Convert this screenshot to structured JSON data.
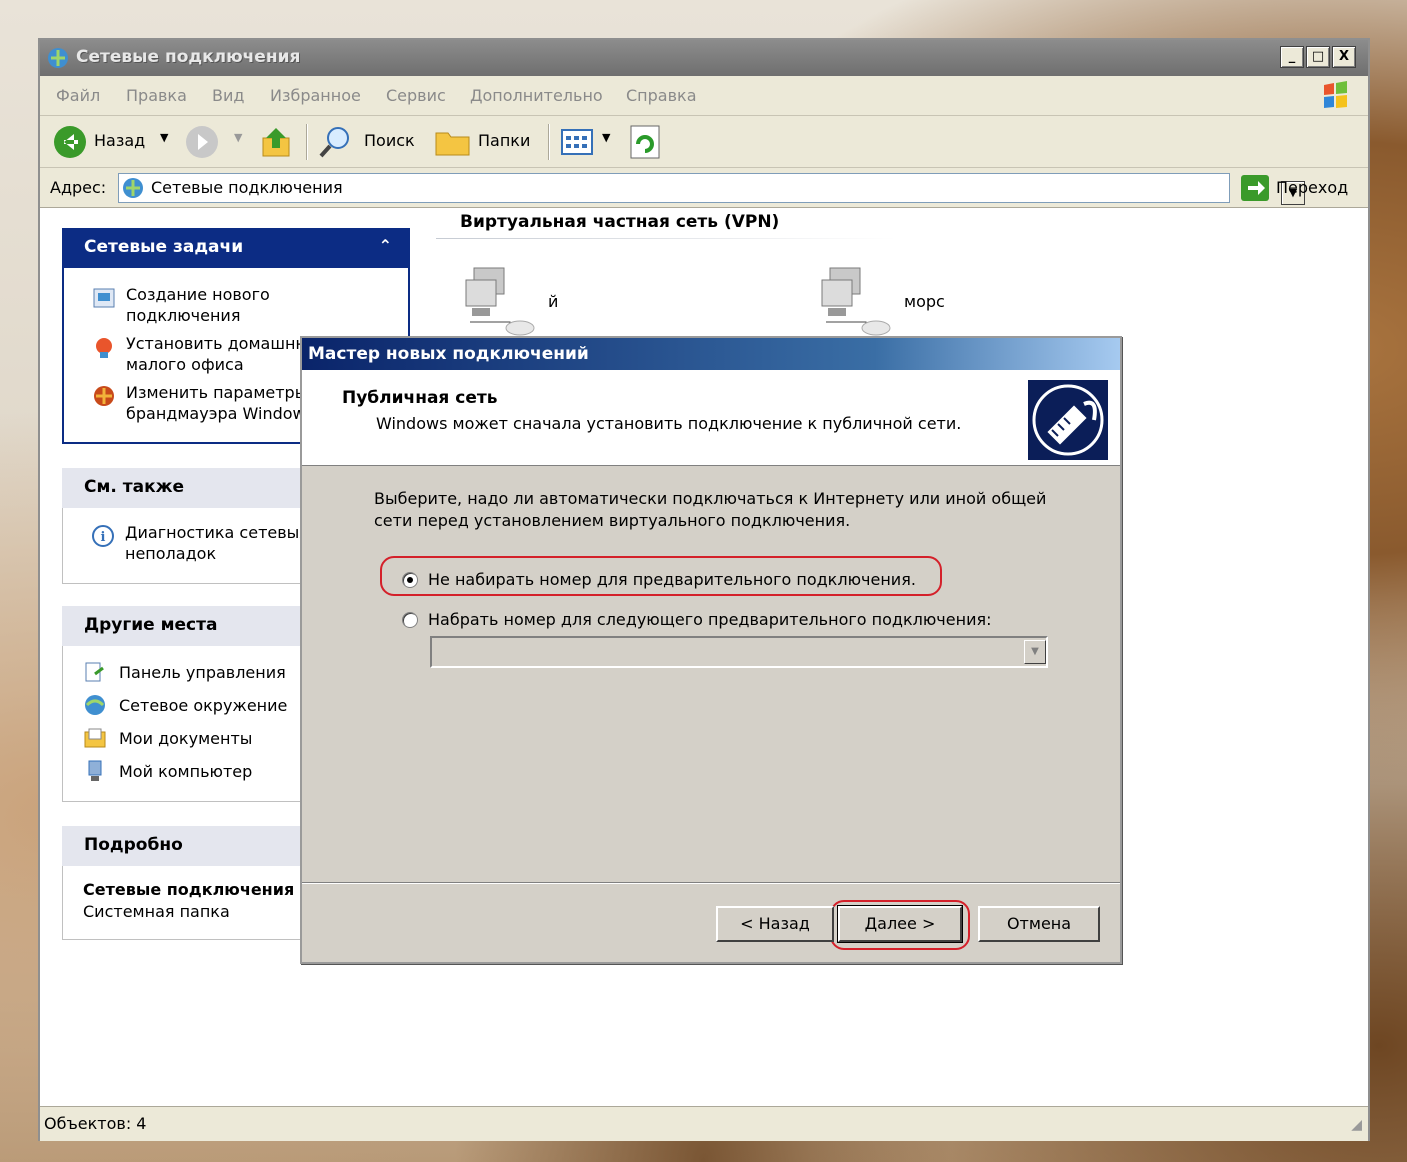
{
  "window": {
    "title": "Сетевые подключения",
    "controls": [
      "_",
      "□",
      "X"
    ]
  },
  "menu": [
    "Файл",
    "Правка",
    "Вид",
    "Избранное",
    "Сервис",
    "Дополнительно",
    "Справка"
  ],
  "toolbar": {
    "back": "Назад",
    "search": "Поиск",
    "folders": "Папки"
  },
  "address": {
    "label": "Адрес:",
    "value": "Сетевые подключения",
    "go": "Переход"
  },
  "tasks": {
    "network_tasks": {
      "title": "Сетевые задачи",
      "collapse": "«",
      "items": [
        "Создание нового подключения",
        "Установить домашнюю или сеть малого офиса",
        "Изменить параметры брандмауэра Windows"
      ]
    },
    "see_also": {
      "title": "См. также",
      "items": [
        "Диагностика сетевых неполадок"
      ]
    },
    "other_places": {
      "title": "Другие места",
      "items": [
        "Панель управления",
        "Сетевое окружение",
        "Мои документы",
        "Мой компьютер"
      ]
    },
    "details": {
      "title": "Подробно",
      "name": "Сетевые подключения",
      "type": "Системная папка"
    }
  },
  "content": {
    "group_title": "Виртуальная частная сеть (VPN)",
    "connections": [
      "й",
      "морс"
    ]
  },
  "status": {
    "text": "Объектов: 4"
  },
  "dialog": {
    "title": "Мастер новых подключений",
    "header_title": "Публичная сеть",
    "header_subtitle": "Windows может сначала установить подключение к публичной сети.",
    "description": "Выберите, надо ли автоматически подключаться к Интернету или иной общей сети перед установлением виртуального подключения.",
    "option_no_dial": "Не набирать номер для предварительного подключения.",
    "option_dial": "Набрать номер для следующего предварительного подключения:",
    "selected": "option_no_dial",
    "combo_value": "",
    "buttons": {
      "back": "< Назад",
      "next": "Далее >",
      "cancel": "Отмена"
    }
  },
  "colors": {
    "highlight_annotation": "#d4202a",
    "dialog_title_bg": "#0a246a"
  }
}
